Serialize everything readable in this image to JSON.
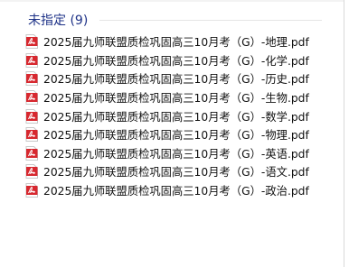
{
  "group": {
    "title": "未指定 (9)"
  },
  "files": [
    {
      "name": "2025届九师联盟质检巩固高三10月考（G）-地理.pdf",
      "icon": "pdf-file-icon"
    },
    {
      "name": "2025届九师联盟质检巩固高三10月考（G）-化学.pdf",
      "icon": "pdf-file-icon"
    },
    {
      "name": "2025届九师联盟质检巩固高三10月考（G）-历史.pdf",
      "icon": "pdf-file-icon"
    },
    {
      "name": "2025届九师联盟质检巩固高三10月考（G）-生物.pdf",
      "icon": "pdf-file-icon"
    },
    {
      "name": "2025届九师联盟质检巩固高三10月考（G）-数学.pdf",
      "icon": "pdf-file-icon"
    },
    {
      "name": "2025届九师联盟质检巩固高三10月考（G）-物理.pdf",
      "icon": "pdf-file-icon"
    },
    {
      "name": "2025届九师联盟质检巩固高三10月考（G）-英语.pdf",
      "icon": "pdf-file-icon"
    },
    {
      "name": "2025届九师联盟质检巩固高三10月考（G）-语文.pdf",
      "icon": "pdf-file-icon"
    },
    {
      "name": "2025届九师联盟质检巩固高三10月考（G）-政治.pdf",
      "icon": "pdf-file-icon"
    }
  ],
  "colors": {
    "group_title": "#1e3287",
    "pdf_red": "#d7282f"
  }
}
